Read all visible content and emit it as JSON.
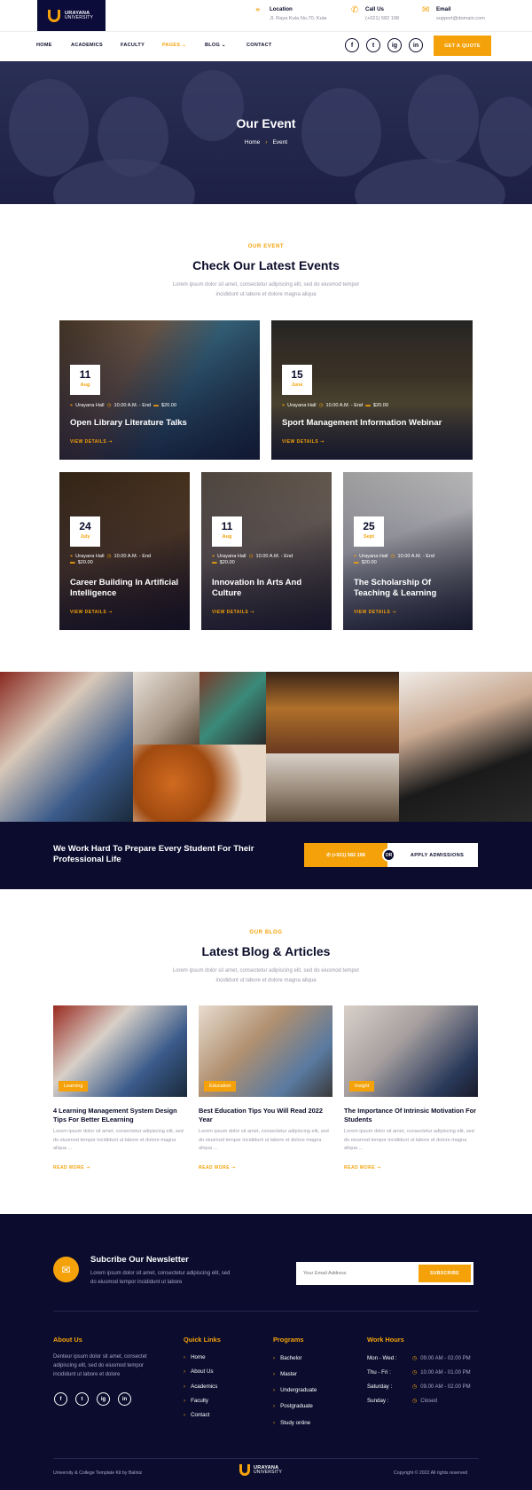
{
  "brand": {
    "name": "URAYANA",
    "sub": "UNIVERSITY"
  },
  "contact": {
    "location": {
      "label": "Location",
      "value": "Jl. Raya Kuta No.70, Kuta",
      "icon": "map-pin-icon"
    },
    "call": {
      "label": "Call Us",
      "value": "(+021) 582 198",
      "icon": "phone-icon"
    },
    "email": {
      "label": "Email",
      "value": "support@domain.com",
      "icon": "mail-icon"
    }
  },
  "nav": {
    "items": [
      "HOME",
      "ACADEMICS",
      "FACULTY",
      "PAGES",
      "BLOG",
      "CONTACT"
    ],
    "social": [
      "f",
      "t",
      "ig",
      "in"
    ],
    "quote": "GET A QUOTE"
  },
  "hero": {
    "title": "Our Event",
    "crumb_home": "Home",
    "crumb_current": "Event"
  },
  "events_section": {
    "eyebrow": "OUR EVENT",
    "title": "Check Our Latest Events",
    "desc": "Lorem ipsum dolor sit amet, consectetur adipiscing elit, sed do eiusmod tempor incididunt ut labore et dolore magna aliqua",
    "link_label": "VIEW DETAILS"
  },
  "events": [
    {
      "day": "11",
      "month": "Aug",
      "place": "Urayana Hall",
      "time": "10.00 A.M. - End",
      "price": "$20.00",
      "title": "Open Library Literature Talks"
    },
    {
      "day": "15",
      "month": "June",
      "place": "Urayana Hall",
      "time": "10.00 A.M. - End",
      "price": "$20.00",
      "title": "Sport Management Information Webinar"
    },
    {
      "day": "24",
      "month": "July",
      "place": "Urayana Hall",
      "time": "10.00 A.M. - End",
      "price": "$20.00",
      "title": "Career Building In Artificial Intelligence"
    },
    {
      "day": "11",
      "month": "Aug",
      "place": "Urayana Hall",
      "time": "10.00 A.M. - End",
      "price": "$20.00",
      "title": "Innovation In Arts And Culture"
    },
    {
      "day": "25",
      "month": "Sept",
      "place": "Urayana Hall",
      "time": "10.00 A.M. - End",
      "price": "$20.00",
      "title": "The Scholarship Of Teaching & Learning"
    }
  ],
  "cta": {
    "text": "We Work Hard To Prepare Every Student For Their Professional Life",
    "phone": "(+021) 582 198",
    "or": "OR",
    "apply": "APPLY ADMISSIONS"
  },
  "blog_section": {
    "eyebrow": "OUR BLOG",
    "title": "Latest Blog & Articles",
    "desc": "Lorem ipsum dolor sit amet, consectetur adipiscing elit, sed do eiusmod tempor incididunt ut labore et dolore magna aliqua",
    "link_label": "READ MORE"
  },
  "posts": [
    {
      "tag": "Learning",
      "title": "4 Learning Management System Design Tips For Better ELearning",
      "desc": "Lorem ipsum dolor sit amet, consectetur adipiscing elit, sed do eiusmod tempor incididunt ut labore et dolore magna aliqua ..."
    },
    {
      "tag": "Education",
      "title": "Best Education Tips You Will Read 2022 Year",
      "desc": "Lorem ipsum dolor sit amet, consectetur adipiscing elit, sed do eiusmod tempor incididunt ut labore et dolore magna aliqua ..."
    },
    {
      "tag": "Insight",
      "title": "The Importance Of Intrinsic Motivation For Students",
      "desc": "Lorem ipsum dolor sit amet, consectetur adipiscing elit, sed do eiusmod tempor incididunt ut labore et dolore magna aliqua ..."
    }
  ],
  "newsletter": {
    "title": "Subcribe Our Newsletter",
    "desc": "Lorem ipsum dolor sit amet, consectetur adipiscing elit, sed do eiusmod tempor incididunt ut labore",
    "placeholder": "Your Email Address",
    "button": "SUBSCRIBE"
  },
  "footer": {
    "about_head": "About Us",
    "about_text": "Denteur ipsum dolor sit amet, consectet adipiscing elit, sed do eiusmod tempor incididunt ut labore et dolore",
    "quick_head": "Quick Links",
    "quick_links": [
      "Home",
      "About Us",
      "Academics",
      "Faculty",
      "Contact"
    ],
    "programs_head": "Programs",
    "programs": [
      "Bachelor",
      "Master",
      "Undergraduate",
      "Postgraduate",
      "Study online"
    ],
    "hours_head": "Work Hours",
    "hours": [
      {
        "day": "Mon - Wed :",
        "time": "09.00 AM - 02.00 PM"
      },
      {
        "day": "Thu - Fri :",
        "time": "10.00 AM - 01.00 PM"
      },
      {
        "day": "Saturday :",
        "time": "09.00 AM - 02.00 PM"
      },
      {
        "day": "Sunday :",
        "time": "Closed"
      }
    ],
    "credit": "University & College Template Kit by Baliniz",
    "copyright": "Copyright © 2022 All rights reserved"
  },
  "colors": {
    "accent": "#f5a20a",
    "navy": "#0b0c2e"
  }
}
